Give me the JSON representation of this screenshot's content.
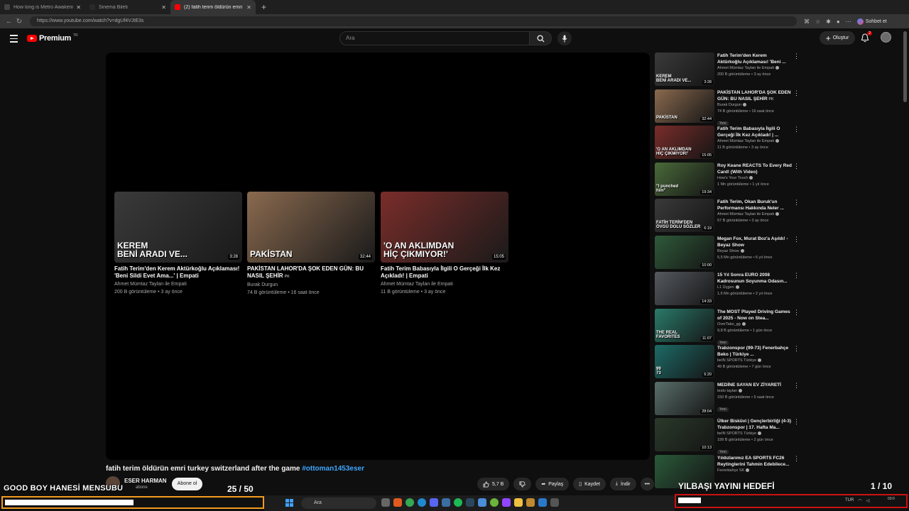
{
  "browser": {
    "tabs": [
      {
        "title": "How long is Metro Awakening? | H",
        "favicon_color": "#444444",
        "active": false
      },
      {
        "title": "Sinema Bileti",
        "favicon_color": "#2a2a2a",
        "active": false
      },
      {
        "title": "(2) fatih terim öldürün emri turkey",
        "favicon_color": "#ff0000",
        "active": true
      }
    ],
    "new_tab": "+",
    "url": "https://www.youtube.com/watch?v=dgUf4VJtE3s",
    "chat_label": "Sohbet et"
  },
  "youtube": {
    "brand": "Premium",
    "country": "TR",
    "search_placeholder": "Ara",
    "create_label": "Oluştur",
    "notif_count": "2"
  },
  "endcards": [
    {
      "overlay": "KEREM\nBENİ ARADI VE...",
      "duration": "3:28",
      "title": "Fatih Terim'den Kerem Aktürkoğlu Açıklaması! 'Beni Sildi Evet Ama...' | Empati",
      "channel": "Ahmet Mümtaz Taylan ile Empati",
      "stats": "200 B görüntüleme • 3 ay önce",
      "color": "#3a3a3a"
    },
    {
      "overlay": "PAKİSTAN",
      "duration": "32:44",
      "title": "PAKİSTAN LAHOR'DA ŞOK EDEN GÜN: BU NASIL ŞEHİR",
      "title_suffix": "PK",
      "channel": "Burak Durgun",
      "stats": "74 B görüntüleme • 16 saat önce",
      "color": "#8a6a4f"
    },
    {
      "overlay": "'O AN AKLIMDAN\nHİÇ ÇIKMIYOR!'",
      "duration": "15:05",
      "title": "Fatih Terim Babasıyla İlgili O Gerçeği İlk Kez Açıkladı! | Empati",
      "channel": "Ahmet Mümtaz Taylan ile Empati",
      "stats": "11 B görüntüleme • 3 ay önce",
      "color": "#7a2d2a"
    }
  ],
  "video": {
    "title": "fatih terim öldürün emri turkey switzerland after the game",
    "hashtag": "#ottoman1453eser",
    "channel": "ESER HARMAN",
    "subs": "abone",
    "subscribe_label": "Abone ol",
    "likes": "5,7 B",
    "share_label": "Paylaş",
    "save_label": "Kaydet",
    "download_label": "İndir",
    "more_label": "•••"
  },
  "recommendations": [
    {
      "title": "Fatih Terim'den Kerem Aktürkoğlu Açıklaması! 'Beni ...",
      "channel": "Ahmet Mümtaz Taylan ile Empati",
      "stats": "200 B görüntüleme • 3 ay önce",
      "duration": "3:28",
      "overlay": "KEREM\nBENİ ARADI VE...",
      "color": "#3a3a3a",
      "new": ""
    },
    {
      "title": "PAKİSTAN LAHOR'DA ŞOK EDEN GÜN: BU NASIL ŞEHİR",
      "title_suffix": "PK",
      "channel": "Burak Durgun",
      "stats": "74 B görüntüleme • 16 saat önce",
      "duration": "32:44",
      "overlay": "PAKİSTAN",
      "color": "#8a6a4f",
      "new": "Yeni"
    },
    {
      "title": "Fatih Terim Babasıyla İlgili O Gerçeği İlk Kez Açıkladı! | ...",
      "channel": "Ahmet Mümtaz Taylan ile Empati",
      "stats": "11 B görüntüleme • 3 ay önce",
      "duration": "15:05",
      "overlay": "'O AN AKLIMDAN\nHİÇ ÇIKMIYOR!'",
      "color": "#7a2d2a",
      "new": ""
    },
    {
      "title": "Roy Keane REACTS To Every Red Card! (With Video)",
      "channel": "How's Your Touch",
      "stats": "1 Mn görüntüleme • 1 yıl önce",
      "duration": "19:34",
      "overlay": "\"I punched\nhim\"",
      "color": "#4a6a3a",
      "new": ""
    },
    {
      "title": "Fatih Terim, Okan Buruk'un Performansı Hakkında Neler ...",
      "channel": "Ahmet Mümtaz Taylan ile Empati",
      "stats": "57 B görüntüleme • 3 ay önce",
      "duration": "6:19",
      "overlay": "FATİH TERİM'DEN\nÖVGÜ DOLU SÖZLER",
      "color": "#3a3a3a",
      "new": ""
    },
    {
      "title": "Megan Fox, Murat Boz'a Aşıldı! - Beyaz Show",
      "channel": "Beyaz Show",
      "stats": "5,5 Mn görüntüleme • 6 yıl önce",
      "duration": "10:00",
      "overlay": "",
      "color": "#2f5a3a",
      "new": ""
    },
    {
      "title": "15 Yıl Sonra EURO 2008 Kadrosunun Soyunma Odasın...",
      "channel": "L1 Üçgen",
      "stats": "1,6 Mn görüntüleme • 2 yıl önce",
      "duration": "14:33",
      "overlay": "",
      "color": "#555a60",
      "new": ""
    },
    {
      "title": "The MOST Played Driving Games of 2025 - Now on Stea...",
      "channel": "OverTake_gg",
      "stats": "9,8 B görüntüleme • 1 gün önce",
      "duration": "11:07",
      "overlay": "THE REAL\nFAVORITES",
      "color": "#2a7a6a",
      "new": "Yeni"
    },
    {
      "title": "Trabzonspor (99-73) Fenerbahçe Beko | Türkiye ...",
      "channel": "beIN SPORTS Türkiye",
      "stats": "49 B görüntüleme • 7 gün önce",
      "duration": "6:20",
      "overlay": "99\n73",
      "color": "#1d6a66",
      "new": ""
    },
    {
      "title": "MEDİNE SAYAN EV ZİYARETİ",
      "channel": "testo taylan",
      "stats": "150 B görüntüleme • 5 saat önce",
      "duration": "28:04",
      "overlay": "",
      "color": "#5a6f6a",
      "new": "Yeni"
    },
    {
      "title": "Ülker Bisküvi | Gençlerbirliği (4-3) Trabzonspor | 17. Hafta Ma...",
      "channel": "beIN SPORTS Türkiye",
      "stats": "199 B görüntüleme • 2 gün önce",
      "duration": "10:13",
      "overlay": "",
      "color": "#2a3a2a",
      "new": "Yeni"
    },
    {
      "title": "Yıldızlarımız EA SPORTS FC26 Reytinglerini Tahmin Edebilece...",
      "channel": "Fenerbahçe SK",
      "stats": "",
      "duration": "",
      "overlay": "",
      "color": "#2a5a3a",
      "new": ""
    }
  ],
  "overlays": {
    "left_text": "GOOD BOY HANESİ MENSUBU",
    "left_count": "25  / 50",
    "left_progress": 0.5,
    "right_text": "YILBAŞI YAYINI HEDEFİ",
    "right_count": "1 / 10",
    "right_progress": 0.1
  },
  "taskbar": {
    "search_placeholder": "Ara",
    "tray_lang": "TUR",
    "time": "03:0"
  }
}
